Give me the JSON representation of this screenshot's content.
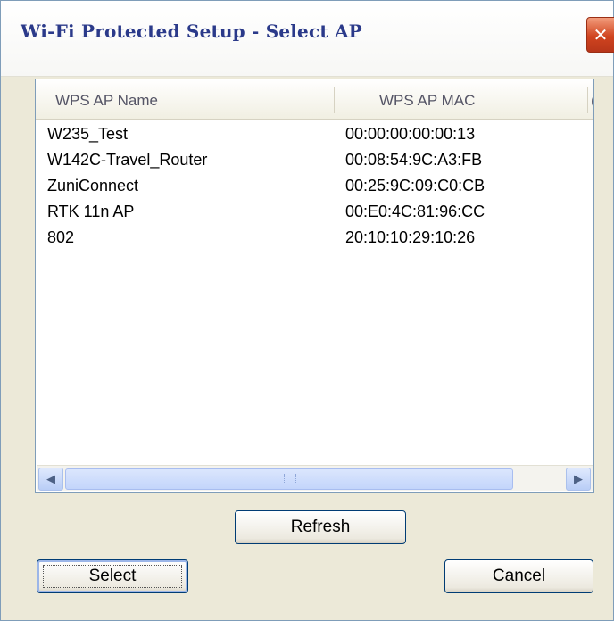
{
  "window": {
    "title": "Wi-Fi Protected Setup - Select AP",
    "close_glyph": "✕"
  },
  "list": {
    "columns": [
      "WPS AP Name",
      "WPS AP MAC",
      "("
    ],
    "rows": [
      {
        "name": "W235_Test",
        "mac": "00:00:00:00:00:13"
      },
      {
        "name": "W142C-Travel_Router",
        "mac": "00:08:54:9C:A3:FB"
      },
      {
        "name": "ZuniConnect",
        "mac": "00:25:9C:09:C0:CB"
      },
      {
        "name": "RTK 11n AP",
        "mac": "00:E0:4C:81:96:CC"
      },
      {
        "name": "802",
        "mac": "20:10:10:29:10:26"
      }
    ],
    "scroll_left_glyph": "◀",
    "scroll_right_glyph": "▶",
    "scroll_grip_glyph": "III"
  },
  "buttons": {
    "refresh": "Refresh",
    "select": "Select",
    "cancel": "Cancel"
  }
}
